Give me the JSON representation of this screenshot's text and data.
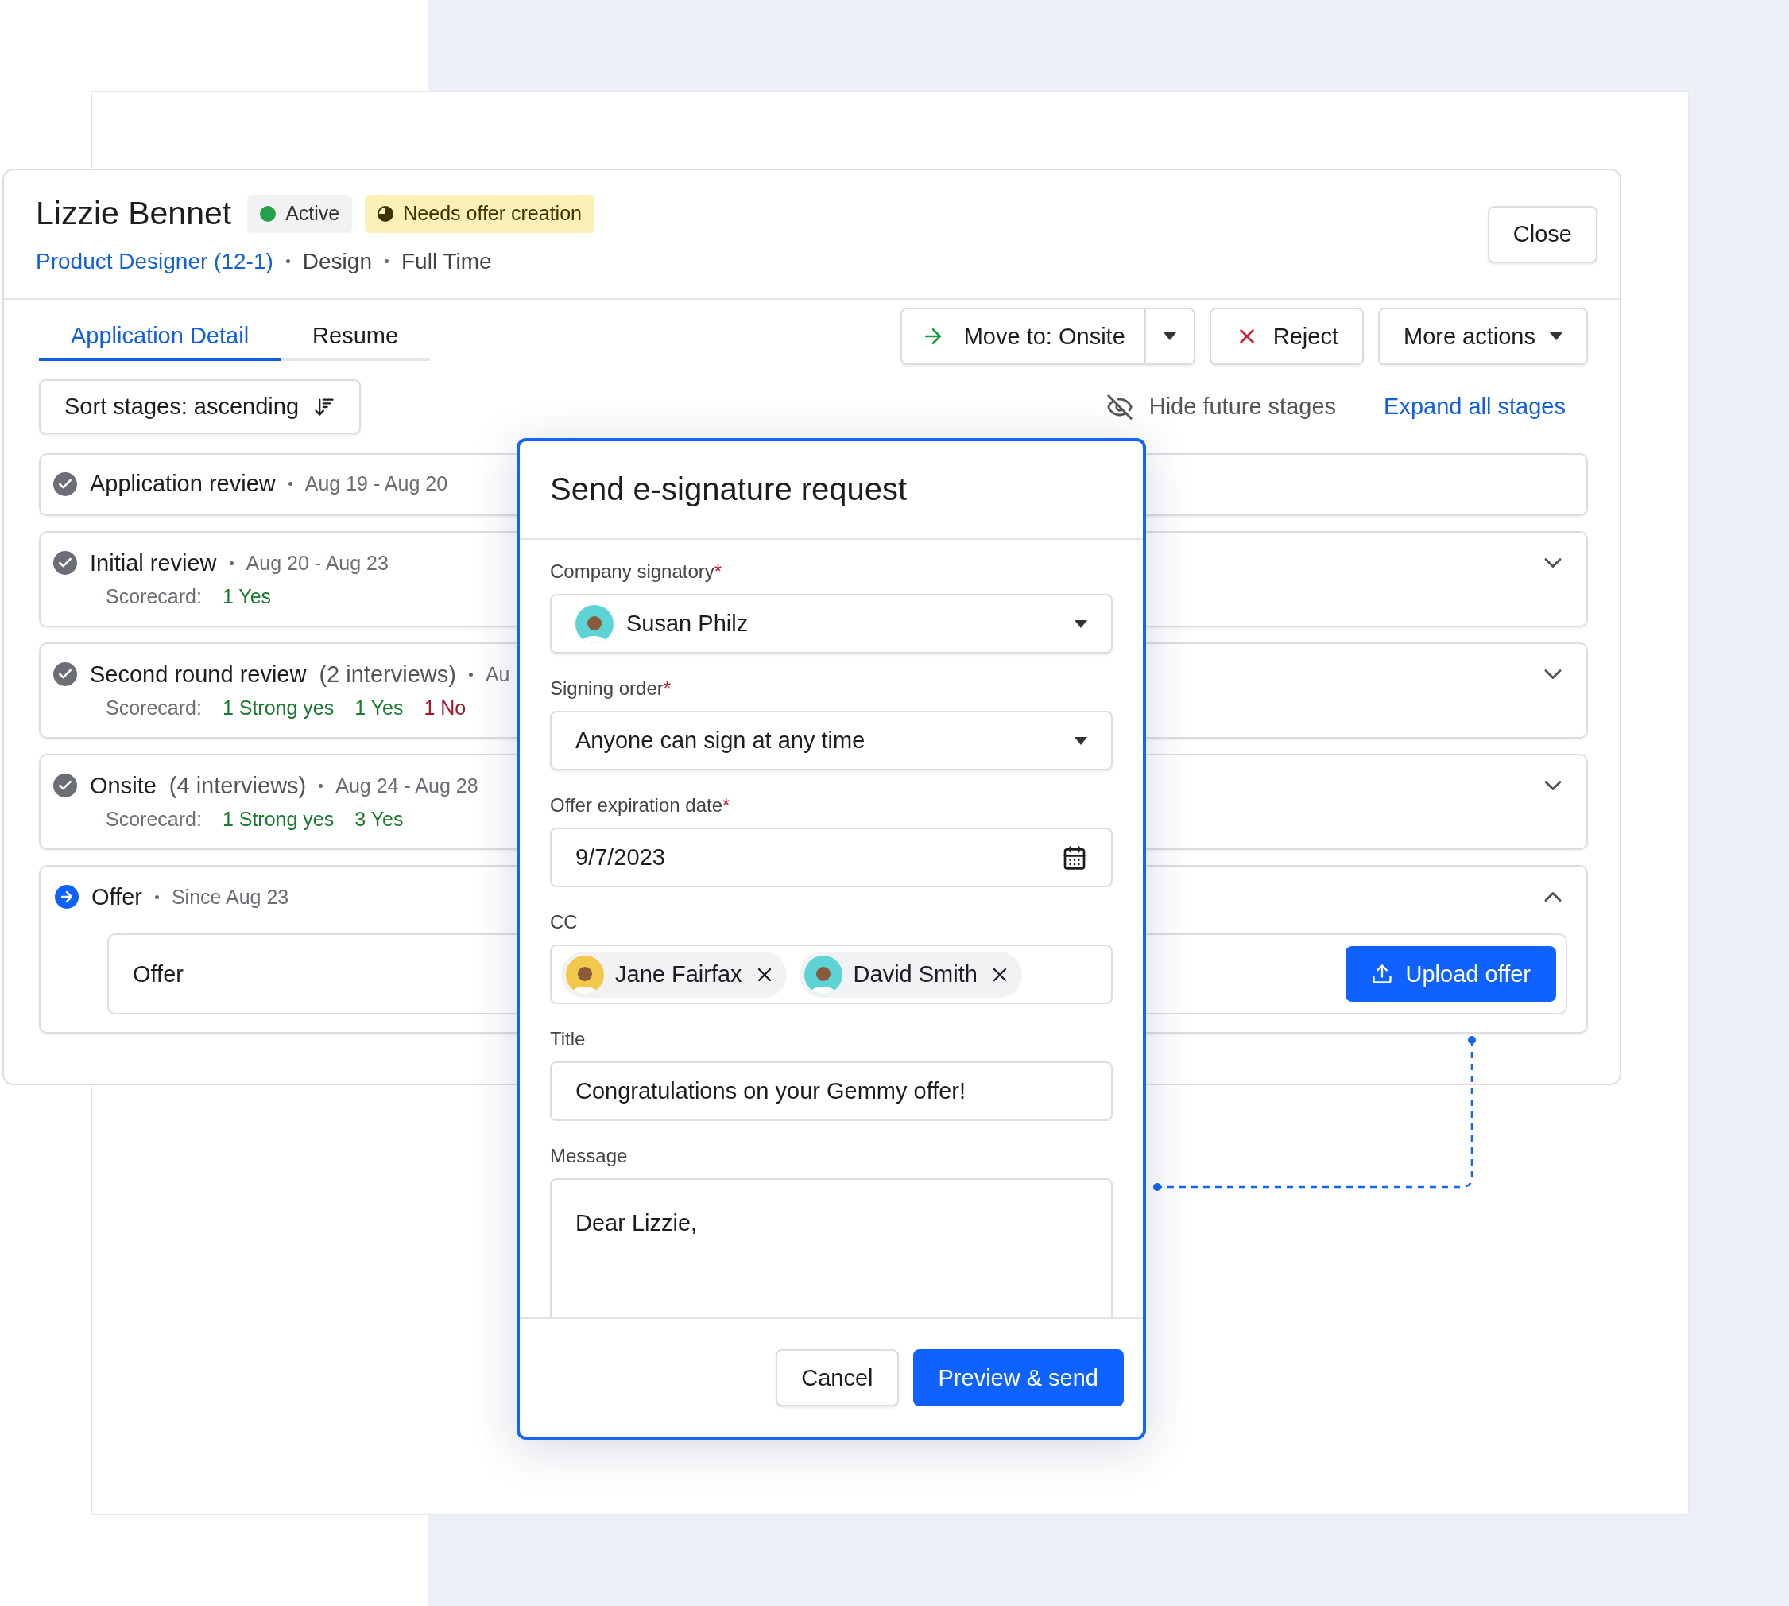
{
  "candidate": {
    "name": "Lizzie Bennet",
    "badges": [
      {
        "label": "Active",
        "kind": "status"
      },
      {
        "label": "Needs offer creation",
        "kind": "warning"
      }
    ],
    "job_link": "Product Designer (12-1)",
    "meta": [
      "Design",
      "Full Time"
    ],
    "close_button": "Close"
  },
  "tabs": [
    {
      "label": "Application Detail",
      "selected": true
    },
    {
      "label": "Resume",
      "selected": false
    }
  ],
  "actions": {
    "move_to": "Move to: Onsite",
    "reject": "Reject",
    "more": "More actions"
  },
  "sort_button": "Sort stages: ascending",
  "hide_future": "Hide future stages",
  "expand_all": "Expand all stages",
  "stages": [
    {
      "title": "Application review",
      "date": "Aug 19 - Aug 20",
      "kind": "done"
    },
    {
      "title": "Initial review",
      "date": "Aug 20 - Aug 23",
      "kind": "done",
      "expanded": false,
      "scorecard": {
        "label": "Scorecard:",
        "scores": [
          {
            "text": "1 Yes",
            "kind": "positive"
          }
        ]
      }
    },
    {
      "title": "Second round review",
      "detail": "(2 interviews)",
      "date": "Au",
      "kind": "done",
      "expanded": false,
      "scorecard": {
        "label": "Scorecard:",
        "scores": [
          {
            "text": "1 Strong yes",
            "kind": "positive"
          },
          {
            "text": "1 Yes",
            "kind": "positive"
          },
          {
            "text": "1 No",
            "kind": "negative"
          }
        ]
      }
    },
    {
      "title": "Onsite",
      "detail": "(4 interviews)",
      "date": "Aug 24 - Aug 28",
      "kind": "done",
      "expanded": false,
      "scorecard": {
        "label": "Scorecard:",
        "scores": [
          {
            "text": "1 Strong yes",
            "kind": "positive"
          },
          {
            "text": "3 Yes",
            "kind": "positive"
          }
        ]
      }
    },
    {
      "title": "Offer",
      "date": "Since Aug 23",
      "kind": "current",
      "expanded": true,
      "panel": {
        "label": "Offer",
        "button": "Upload offer"
      }
    }
  ],
  "modal": {
    "title": "Send e-signature request",
    "fields": [
      {
        "kind": "person-select",
        "label": "Company signatory",
        "required_mark": "*",
        "value": "Susan Philz",
        "color": "#5dd3d6"
      },
      {
        "kind": "select",
        "label": "Signing order",
        "required_mark": "*",
        "value": "Anyone can sign at any time"
      },
      {
        "kind": "date",
        "label": "Offer expiration date",
        "required_mark": "*",
        "value": "9/7/2023"
      },
      {
        "kind": "chips",
        "label": "CC",
        "chips": [
          {
            "name": "Jane Fairfax",
            "color": "#f2c84b"
          },
          {
            "name": "David Smith",
            "color": "#5dd3d6"
          }
        ]
      },
      {
        "kind": "text",
        "label": "Title",
        "value": "Congratulations on your Gemmy offer!"
      },
      {
        "kind": "textarea",
        "label": "Message",
        "value": "Dear Lizzie,"
      }
    ],
    "cancel": "Cancel",
    "submit": "Preview & send"
  }
}
